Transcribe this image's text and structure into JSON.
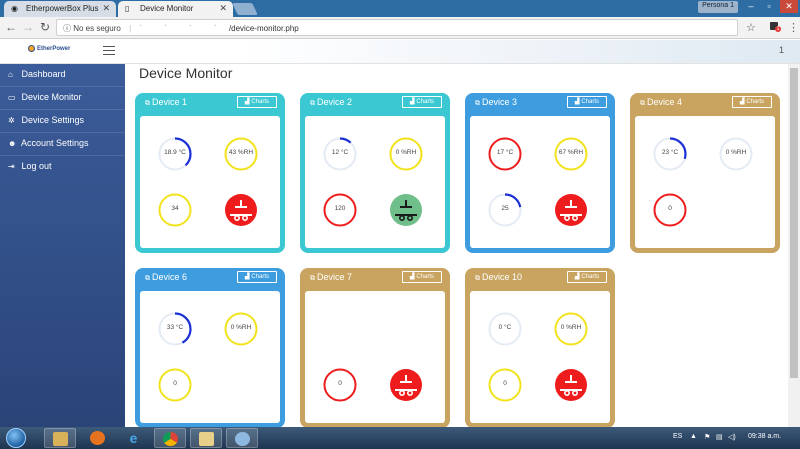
{
  "browser": {
    "tabs": [
      {
        "label": "EtherpowerBox Plus",
        "active": false
      },
      {
        "label": "Device Monitor",
        "active": true
      }
    ],
    "profile": "Persona 1",
    "security_label": "No es seguro",
    "url_host": "` ` ` `",
    "url_path": "/device-monitor.php"
  },
  "header": {
    "logo_text": "EtherPower",
    "count": "1"
  },
  "sidebar": {
    "items": [
      {
        "icon": "⌂",
        "label": "Dashboard"
      },
      {
        "icon": "▭",
        "label": "Device Monitor"
      },
      {
        "icon": "✲",
        "label": "Device Settings"
      },
      {
        "icon": "☻",
        "label": "Account Settings"
      },
      {
        "icon": "⇥",
        "label": "Log out"
      }
    ]
  },
  "page": {
    "title": "Device Monitor",
    "charts_label": "Charts"
  },
  "colors": {
    "teal": "#3cc8d2",
    "blue": "#3d9ddf",
    "gold": "#c8a460",
    "gauge_blue": "#1a2fd4",
    "gauge_yellow": "#f2e21b",
    "gauge_red": "#ee1c1c",
    "gauge_track": "#e4ebf4",
    "switch_on": "#ee1c1c",
    "switch_off": "#6fbf8a"
  },
  "devices": [
    {
      "name": "Device 1",
      "color": "teal",
      "widgets": [
        {
          "type": "gauge",
          "value": "18.9 °C",
          "ring": "track",
          "arc": 0.38
        },
        {
          "type": "gauge",
          "value": "43 %RH",
          "ring": "yellow",
          "arc": 0
        },
        {
          "type": "gauge",
          "value": "34",
          "ring": "yellow",
          "arc": 0
        },
        {
          "type": "switch",
          "state": "on"
        }
      ]
    },
    {
      "name": "Device 2",
      "color": "teal",
      "widgets": [
        {
          "type": "gauge",
          "value": "12 °C",
          "ring": "track",
          "arc": 0.12
        },
        {
          "type": "gauge",
          "value": "0 %RH",
          "ring": "yellow",
          "arc": 0
        },
        {
          "type": "gauge",
          "value": "120",
          "ring": "red",
          "arc": 0
        },
        {
          "type": "switch",
          "state": "off"
        }
      ]
    },
    {
      "name": "Device 3",
      "color": "blue",
      "widgets": [
        {
          "type": "gauge",
          "value": "17 °C",
          "ring": "red",
          "arc": 0
        },
        {
          "type": "gauge",
          "value": "67 %RH",
          "ring": "yellow",
          "arc": 0
        },
        {
          "type": "gauge",
          "value": "25",
          "ring": "track",
          "arc": 0.22
        },
        {
          "type": "switch",
          "state": "on"
        }
      ]
    },
    {
      "name": "Device 4",
      "color": "gold",
      "widgets": [
        {
          "type": "gauge",
          "value": "23 °C",
          "ring": "track",
          "arc": 0.3
        },
        {
          "type": "gauge",
          "value": "0 %RH",
          "ring": "track",
          "arc": 0
        },
        {
          "type": "gauge",
          "value": "0",
          "ring": "red",
          "arc": 0
        }
      ]
    },
    {
      "name": "Device 6",
      "color": "blue",
      "widgets": [
        {
          "type": "gauge",
          "value": "33 °C",
          "ring": "track",
          "arc": 0.42
        },
        {
          "type": "gauge",
          "value": "0 %RH",
          "ring": "yellow",
          "arc": 0
        },
        {
          "type": "gauge",
          "value": "0",
          "ring": "yellow",
          "arc": 0
        }
      ]
    },
    {
      "name": "Device 7",
      "color": "gold",
      "widgets": [
        {
          "type": "empty"
        },
        {
          "type": "empty"
        },
        {
          "type": "gauge",
          "value": "0",
          "ring": "red",
          "arc": 0
        },
        {
          "type": "switch",
          "state": "on"
        }
      ]
    },
    {
      "name": "Device 10",
      "color": "gold",
      "widgets": [
        {
          "type": "gauge",
          "value": "0 °C",
          "ring": "track",
          "arc": 0
        },
        {
          "type": "gauge",
          "value": "0 %RH",
          "ring": "yellow",
          "arc": 0
        },
        {
          "type": "gauge",
          "value": "0",
          "ring": "yellow",
          "arc": 0
        },
        {
          "type": "switch",
          "state": "on"
        }
      ]
    }
  ],
  "taskbar": {
    "lang": "ES",
    "time": "09:38 a.m."
  }
}
